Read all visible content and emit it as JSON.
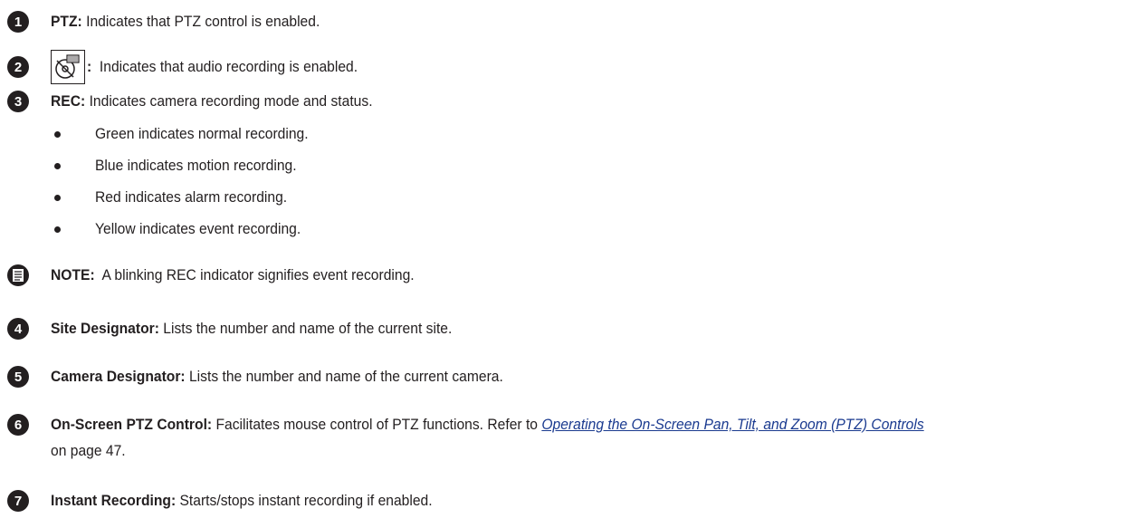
{
  "items": [
    {
      "num": "1",
      "label": "PTZ:",
      "desc": " Indicates that PTZ control is enabled."
    },
    {
      "num": "2",
      "label": ":",
      "desc": "  Indicates that audio recording is enabled.",
      "icon": "audio-record-icon"
    },
    {
      "num": "3",
      "label": "REC:",
      "desc": " Indicates camera recording mode and status."
    },
    {
      "num": "4",
      "label": "Site Designator:",
      "desc": " Lists the number and name of the current site."
    },
    {
      "num": "5",
      "label": "Camera Designator:",
      "desc": " Lists the number and name of the current camera."
    },
    {
      "num": "6",
      "label": "On-Screen PTZ Control:",
      "desc": " Facilitates mouse control of PTZ functions. Refer to ",
      "link": "Operating the On-Screen Pan, Tilt, and Zoom (PTZ) Controls",
      "desc2": "on page 47."
    },
    {
      "num": "7",
      "label": "Instant Recording:",
      "desc": " Starts/stops instant recording if enabled."
    }
  ],
  "rec_bullets": [
    "Green indicates normal recording.",
    "Blue indicates motion recording.",
    "Red indicates alarm recording.",
    "Yellow indicates event recording."
  ],
  "note": {
    "label": "NOTE:",
    "text": "  A blinking REC indicator signifies event recording.",
    "icon": "note-icon"
  }
}
